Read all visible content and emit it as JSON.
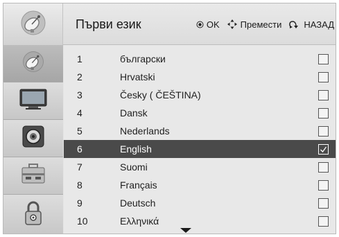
{
  "header": {
    "logo_icon": "satellite-dish-icon",
    "title": "Първи език"
  },
  "hints": [
    {
      "icon": "ok-dot-icon",
      "label": "OK"
    },
    {
      "icon": "move-arrows-icon",
      "label": "Премести"
    },
    {
      "icon": "back-return-icon",
      "label": "НАЗАД"
    }
  ],
  "sidebar": [
    {
      "icon": "satellite-dish-icon",
      "active": true
    },
    {
      "icon": "tv-monitor-icon",
      "active": false
    },
    {
      "icon": "speaker-icon",
      "active": false
    },
    {
      "icon": "toolbox-icon",
      "active": false
    },
    {
      "icon": "padlock-icon",
      "active": false
    }
  ],
  "languages": [
    {
      "num": "1",
      "name": "български",
      "checked": false
    },
    {
      "num": "2",
      "name": "Hrvatski",
      "checked": false
    },
    {
      "num": "3",
      "name": "Česky ( ČEŠTINA)",
      "checked": false
    },
    {
      "num": "4",
      "name": "Dansk",
      "checked": false
    },
    {
      "num": "5",
      "name": "Nederlands",
      "checked": false
    },
    {
      "num": "6",
      "name": "English",
      "checked": true
    },
    {
      "num": "7",
      "name": "Suomi",
      "checked": false
    },
    {
      "num": "8",
      "name": "Français",
      "checked": false
    },
    {
      "num": "9",
      "name": "Deutsch",
      "checked": false
    },
    {
      "num": "10",
      "name": "Ελληνικά",
      "checked": false
    }
  ],
  "colors": {
    "selected_row_bg": "#4a4a4a",
    "panel_bg": "#e8e8e8",
    "sidebar_active_bg": "#b0b0b0"
  },
  "scroll_indicator": "down-triangle-icon"
}
